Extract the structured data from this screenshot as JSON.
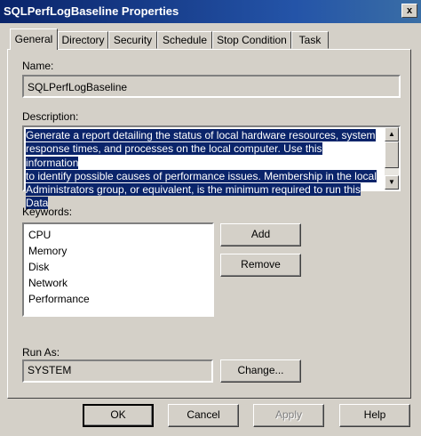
{
  "window": {
    "title": "SQLPerfLogBaseline Properties",
    "close_glyph": "x"
  },
  "tabs": [
    "General",
    "Directory",
    "Security",
    "Schedule",
    "Stop Condition",
    "Task"
  ],
  "name": {
    "label": "Name:",
    "value": "SQLPerfLogBaseline"
  },
  "description": {
    "label": "Description:",
    "lines": [
      "Generate a report detailing the status of local hardware resources, system",
      "response times, and processes on the local computer. Use this information",
      "to identify possible causes of performance issues. Membership in the local",
      "Administrators group, or equivalent, is the minimum required to run this Data"
    ]
  },
  "keywords": {
    "label": "Keywords:",
    "items": [
      "CPU",
      "Memory",
      "Disk",
      "Network",
      "Performance"
    ],
    "add_label": "Add",
    "remove_label": "Remove"
  },
  "run_as": {
    "label": "Run As:",
    "value": "SYSTEM",
    "change_label": "Change..."
  },
  "buttons": {
    "ok": "OK",
    "cancel": "Cancel",
    "apply": "Apply",
    "help": "Help"
  }
}
